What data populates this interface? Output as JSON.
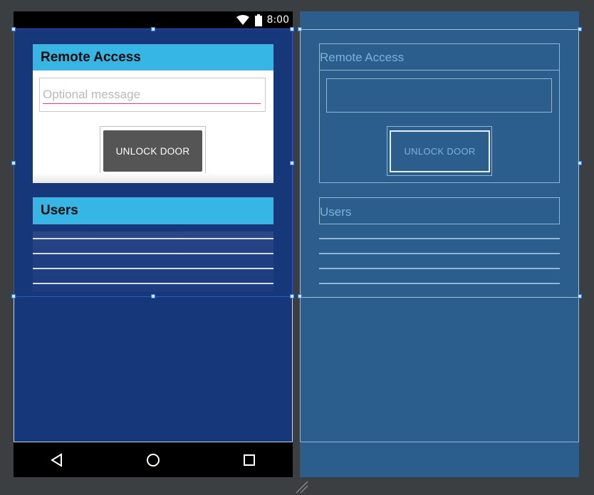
{
  "status_bar": {
    "time": "8:00"
  },
  "remote_access": {
    "title": "Remote Access",
    "message_placeholder": "Optional message",
    "message_value": "",
    "unlock_label": "UNLOCK DOOR"
  },
  "users": {
    "title": "Users"
  },
  "blueprint": {
    "remote_title": "Remote Access",
    "unlock_label": "UNLOCK DOOR",
    "users_title": "Users"
  },
  "nav": {
    "back": "back-icon",
    "home": "home-icon",
    "recents": "recents-icon"
  },
  "colors": {
    "canvas_bg": "#3c3f41",
    "screen_bg": "#163779",
    "title_bar": "#35b6e4",
    "button": "#555555",
    "underline": "#d4417e",
    "blueprint_bg": "#2b5e8c"
  }
}
